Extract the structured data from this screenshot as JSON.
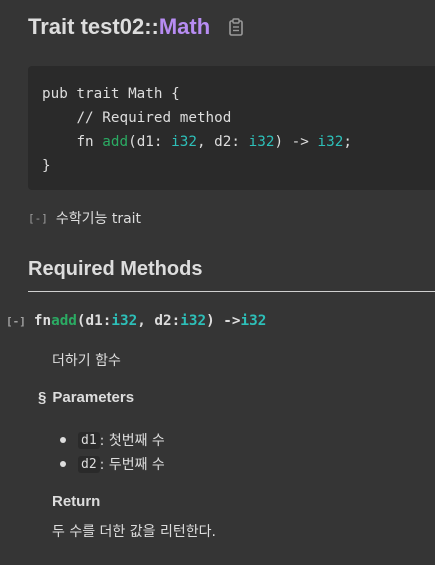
{
  "header": {
    "kind": "Trait",
    "path": "test02",
    "separator": "::",
    "name": "Math",
    "copy_icon": "clipboard-icon"
  },
  "declaration": {
    "line1_kw": "pub trait Math {",
    "comment": "// Required method",
    "fn_kw": "fn ",
    "fn_name": "add",
    "p_open": "(d1: ",
    "ty1": "i32",
    "p_mid": ", d2: ",
    "ty2": "i32",
    "arrow": ") -> ",
    "ret_ty": "i32",
    "semi": ";",
    "close": "}"
  },
  "doc": {
    "toggle": "[-]",
    "summary": "수학기능 trait"
  },
  "required_methods": {
    "heading": "Required Methods",
    "method": {
      "toggle": "[-]",
      "fn_kw": "fn ",
      "name": "add",
      "p_open": "(d1: ",
      "ty1": "i32",
      "p_mid": ", d2: ",
      "ty2": "i32",
      "arrow": ") -> ",
      "ret_ty": "i32",
      "description": "더하기 함수",
      "params_anchor": "§",
      "params_heading": "Parameters",
      "params": [
        {
          "name": "d1",
          "desc": ": 첫번째 수"
        },
        {
          "name": "d2",
          "desc": ": 두번째 수"
        }
      ],
      "return_heading": "Return",
      "return_desc": "두 수를 더한 값을 리턴한다."
    }
  },
  "colors": {
    "background": "#353535",
    "code_background": "#2a2a2a",
    "trait_name": "#b78cf2",
    "fn_name": "#2bab63",
    "type": "#2dbfb8"
  }
}
